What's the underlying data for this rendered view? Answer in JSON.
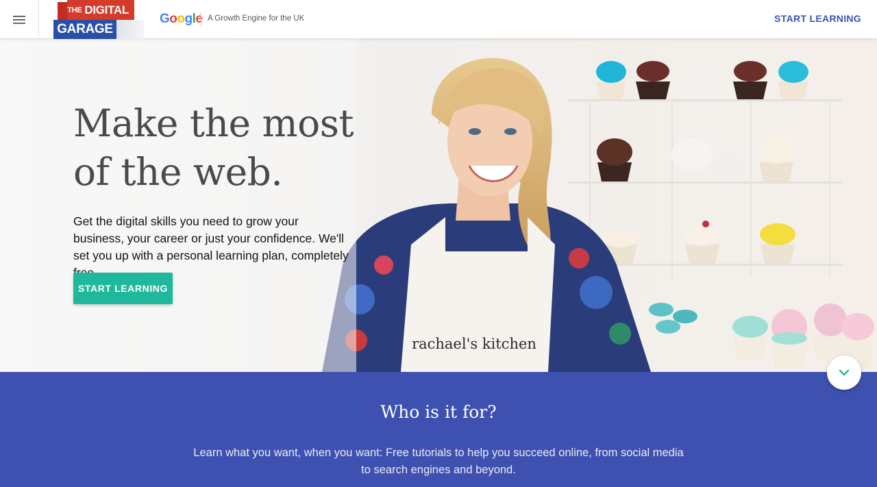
{
  "header": {
    "menu_icon": "hamburger-menu-icon",
    "logo": {
      "line1_small": "THE",
      "line1": "DIGITAL",
      "line2": "GARAGE"
    },
    "google_wordmark": "Google",
    "tagline": "A Growth Engine for the UK",
    "cta_label": "START LEARNING",
    "cta_color": "#3b52b4"
  },
  "hero": {
    "headline": "Make the most of the web.",
    "subtext": "Get the digital skills you need to grow your business, your career or just your confidence. We'll set you up with a personal learning plan, completely free.",
    "cta_label": "START LEARNING",
    "cta_color": "#1fb89c",
    "apron_text": "rachael's kitchen"
  },
  "who": {
    "title": "Who is it for?",
    "text": "Learn what you want, when you want: Free tutorials to help you succeed online, from social media to search engines and beyond.",
    "background": "#3f51b0"
  },
  "scroll_button": {
    "icon": "chevron-down-icon"
  }
}
